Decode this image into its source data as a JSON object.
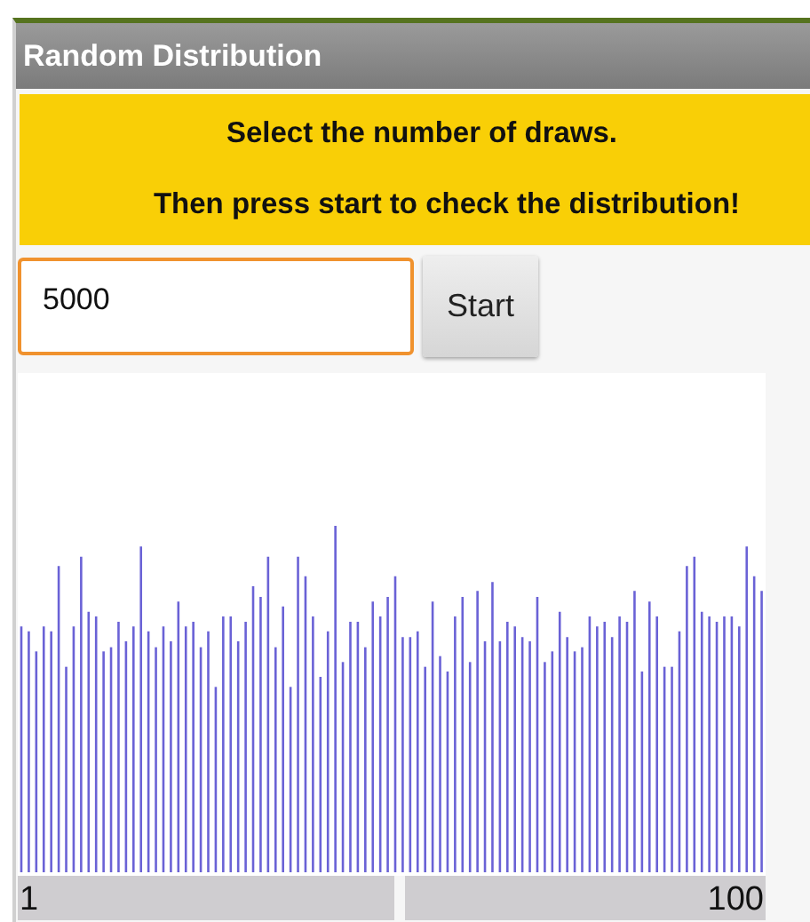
{
  "title_bar": {
    "title": "Random Distribution"
  },
  "instructions": [
    "Select the number of draws.",
    "Then press start to check the distribution!"
  ],
  "draws_field": {
    "value": "5000"
  },
  "start_button": {
    "label": "Start"
  },
  "axis_labels": {
    "min": "1",
    "max": "100"
  }
}
